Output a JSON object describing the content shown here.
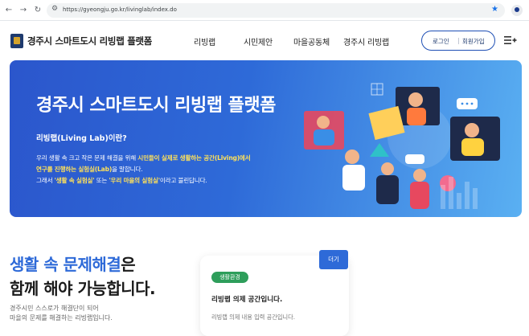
{
  "browser": {
    "url": "https://gyeongju.go.kr/livinglab/index.do"
  },
  "header": {
    "site_title": "경주시 스마트도시 리빙랩 플랫폼",
    "nav": [
      "리빙랩",
      "시민제안",
      "마을공동체",
      "경주시 리빙랩"
    ],
    "login": "로그인",
    "signup": "회원가입"
  },
  "hero": {
    "title": "경주시 스마트도시 리빙랩 플랫폼",
    "question": "리빙랩(Living Lab)이란?",
    "line1_a": "우리 생활 속 크고 작은 문제 해결을 위해 ",
    "line1_b": "시민들이 실제로 생활하는 공간(Living)에서",
    "line2": "연구를 진행하는 실험실(Lab)",
    "line2_b": "을 말합니다.",
    "line3_a": "그래서 ",
    "line3_b": "'생활 속 실험실'",
    "line3_c": " 또는 ",
    "line3_d": "'우리 마을의 실험실'",
    "line3_e": "이라고 불린답니다."
  },
  "section": {
    "headline_blue": "생활 속 문제해결",
    "headline_rest": "은",
    "headline2": "함께 해야 가능합니다.",
    "desc1": "경주시민 스스로가 해결단이 되어",
    "desc2": "마을의 문제를 해결하는 리빙랩입니다."
  },
  "card": {
    "tag": "생활환경",
    "title": "리빙랩 의제 공간입니다.",
    "desc": "리빙랩 의제 내용 입력 공간입니다.",
    "more": "더기"
  },
  "colors": {
    "brand_blue": "#2e6ad8",
    "highlight_yellow": "#ffe15a",
    "tag_green": "#2e9e5b"
  }
}
